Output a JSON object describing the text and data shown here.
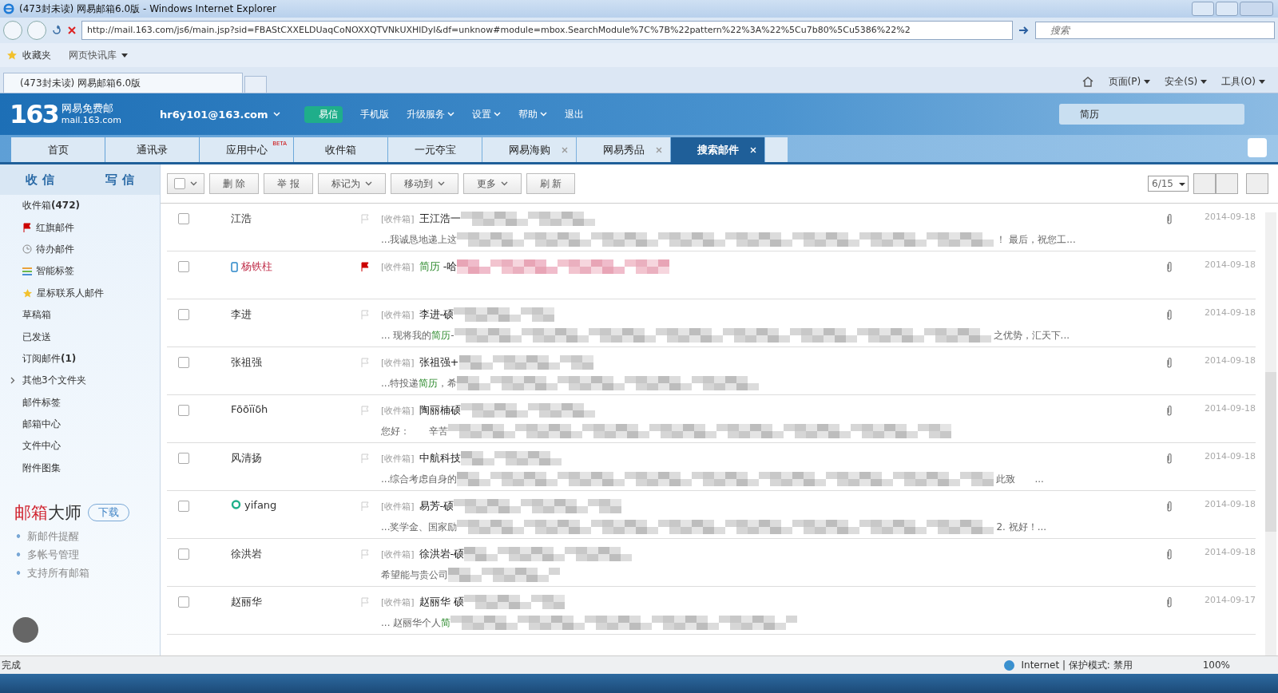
{
  "browser": {
    "title": "(473封未读) 网易邮箱6.0版 - Windows Internet Explorer",
    "address": "http://mail.163.com/js6/main.jsp?sid=FBAStCXXELDUaqCoNOXXQTVNkUXHlDyI&df=unknow#module=mbox.SearchModule%7C%7B%22pattern%22%3A%22%5Cu7b80%5Cu5386%22%2",
    "search_placeholder": "搜索",
    "favorites": "收藏夹",
    "quick_link": "网页快讯库",
    "tab_title": "(473封未读) 网易邮箱6.0版",
    "commands": [
      "页面(P)",
      "安全(S)",
      "工具(O)"
    ]
  },
  "mail": {
    "logo_number": "163",
    "logo_name": "网易免费邮",
    "logo_domain": "mail.163.com",
    "account": "hr6y101@163.com",
    "nav": [
      {
        "label": "易信",
        "kind": "pill"
      },
      {
        "label": "手机版",
        "kind": "plain"
      },
      {
        "label": "升级服务",
        "kind": "menu"
      },
      {
        "label": "设置",
        "kind": "menu"
      },
      {
        "label": "帮助",
        "kind": "menu"
      },
      {
        "label": "退出",
        "kind": "plain"
      }
    ],
    "search_value": "简历",
    "tabs": [
      {
        "label": "首页",
        "selected": false,
        "closable": false
      },
      {
        "label": "通讯录",
        "selected": false,
        "closable": false
      },
      {
        "label": "应用中心",
        "badge": "BETA",
        "selected": false,
        "closable": false
      },
      {
        "label": "收件箱",
        "selected": false,
        "closable": false
      },
      {
        "label": "一元夺宝",
        "selected": false,
        "closable": false
      },
      {
        "label": "网易海购",
        "selected": false,
        "closable": true
      },
      {
        "label": "网易秀品",
        "selected": false,
        "closable": true
      },
      {
        "label": "搜索邮件",
        "selected": true,
        "closable": true
      }
    ],
    "receive": "收 信",
    "compose": "写 信",
    "folders": [
      {
        "label": "收件箱",
        "count": "(472)",
        "kind": "plain",
        "expandable": false
      },
      {
        "label": "红旗邮件",
        "kind": "flag",
        "expandable": false
      },
      {
        "label": "待办邮件",
        "kind": "clock",
        "expandable": false
      },
      {
        "label": "智能标签",
        "kind": "tags",
        "expandable": false
      },
      {
        "label": "星标联系人邮件",
        "kind": "star",
        "expandable": false
      },
      {
        "label": "草稿箱",
        "kind": "plain",
        "expandable": false
      },
      {
        "label": "已发送",
        "kind": "plain",
        "expandable": false
      },
      {
        "label": "订阅邮件",
        "count": "(1)",
        "kind": "plain",
        "expandable": false
      },
      {
        "label": "其他3个文件夹",
        "kind": "plain",
        "expandable": true
      },
      {
        "label": "邮件标签",
        "kind": "plain",
        "expandable": false
      },
      {
        "label": "邮箱中心",
        "kind": "plain",
        "expandable": false
      },
      {
        "label": "文件中心",
        "kind": "plain",
        "expandable": false
      },
      {
        "label": "附件图集",
        "kind": "plain",
        "expandable": false
      }
    ],
    "promo": {
      "title_red": "邮箱",
      "title_dark": "大师",
      "button": "下载",
      "items": [
        "新邮件提醒",
        "多帐号管理",
        "支持所有邮箱"
      ]
    },
    "select_all_checked": false,
    "toolbar": [
      {
        "label": "删 除",
        "dropdown": false
      },
      {
        "label": "举 报",
        "dropdown": false
      },
      {
        "label": "标记为",
        "dropdown": true
      },
      {
        "label": "移动到",
        "dropdown": true
      },
      {
        "label": "更多",
        "dropdown": true
      },
      {
        "label": "刷 新",
        "dropdown": false
      }
    ],
    "page": "6/15",
    "rows": [
      {
        "checked": false,
        "kind": "plain",
        "sender": "江浩",
        "flagged": false,
        "folder": "[收件箱]",
        "subject": [
          {
            "text": "王江浩一",
            "highlight": false
          }
        ],
        "preview": [
          {
            "text": "...我诚恳地递上这",
            "highlight": false
          }
        ],
        "preview_end": "！ 最后，祝您工...",
        "date": "2014-09-18"
      },
      {
        "checked": false,
        "kind": "phone",
        "sender": "杨铁柱",
        "flagged": true,
        "folder": "[收件箱]",
        "subject": [
          {
            "text": "简历",
            "highlight": true
          },
          {
            "text": " -哈",
            "highlight": false
          }
        ],
        "date": "2014-09-18"
      },
      {
        "checked": false,
        "kind": "plain",
        "sender": "李进",
        "flagged": false,
        "folder": "[收件箱]",
        "subject": [
          {
            "text": "李进-硕",
            "highlight": false
          }
        ],
        "preview": [
          {
            "text": "... 现将我的",
            "highlight": false
          },
          {
            "text": "简历",
            "highlight": true
          },
          {
            "text": "-",
            "highlight": false
          }
        ],
        "preview_end": "之优势，汇天下...",
        "date": "2014-09-18"
      },
      {
        "checked": false,
        "kind": "plain",
        "sender": "张祖强",
        "flagged": false,
        "folder": "[收件箱]",
        "subject": [
          {
            "text": "张祖强+",
            "highlight": false
          }
        ],
        "preview": [
          {
            "text": "...特投递",
            "highlight": false
          },
          {
            "text": "简历",
            "highlight": true
          },
          {
            "text": "，希",
            "highlight": false
          }
        ],
        "date": "2014-09-18"
      },
      {
        "checked": false,
        "kind": "plain",
        "sender": "Fōōïïδh",
        "flagged": false,
        "folder": "[收件箱]",
        "subject": [
          {
            "text": "陶丽楠硕",
            "highlight": false
          }
        ],
        "preview": [
          {
            "text": "您好：　　辛苦",
            "highlight": false
          }
        ],
        "date": "2014-09-18"
      },
      {
        "checked": false,
        "kind": "plain",
        "sender": "风清扬",
        "flagged": false,
        "folder": "[收件箱]",
        "subject": [
          {
            "text": "中航科技",
            "highlight": false
          }
        ],
        "preview": [
          {
            "text": "...综合考虑自身的",
            "highlight": false
          }
        ],
        "preview_end": "此致　　...",
        "date": "2014-09-18"
      },
      {
        "checked": false,
        "kind": "yixin",
        "sender": "yifang",
        "flagged": false,
        "folder": "[收件箱]",
        "subject": [
          {
            "text": "易芳-硕",
            "highlight": false
          }
        ],
        "preview": [
          {
            "text": "...奖学金、国家励",
            "highlight": false
          }
        ],
        "preview_end": "2. 祝好！...",
        "date": "2014-09-18"
      },
      {
        "checked": false,
        "kind": "plain",
        "sender": "徐洪岩",
        "flagged": false,
        "folder": "[收件箱]",
        "subject": [
          {
            "text": "徐洪岩-硕",
            "highlight": false
          }
        ],
        "preview": [
          {
            "text": "希望能与贵公司",
            "highlight": false
          }
        ],
        "date": "2014-09-18"
      },
      {
        "checked": false,
        "kind": "plain",
        "sender": "赵丽华",
        "flagged": false,
        "folder": "[收件箱]",
        "subject": [
          {
            "text": "赵丽华 硕",
            "highlight": false
          }
        ],
        "preview": [
          {
            "text": "... 赵丽华个人",
            "highlight": false
          },
          {
            "text": "简",
            "highlight": true
          }
        ],
        "date": "2014-09-17"
      }
    ]
  },
  "status": {
    "text": "完成",
    "zone": "Internet | 保护模式: 禁用",
    "zoom": "100%"
  }
}
